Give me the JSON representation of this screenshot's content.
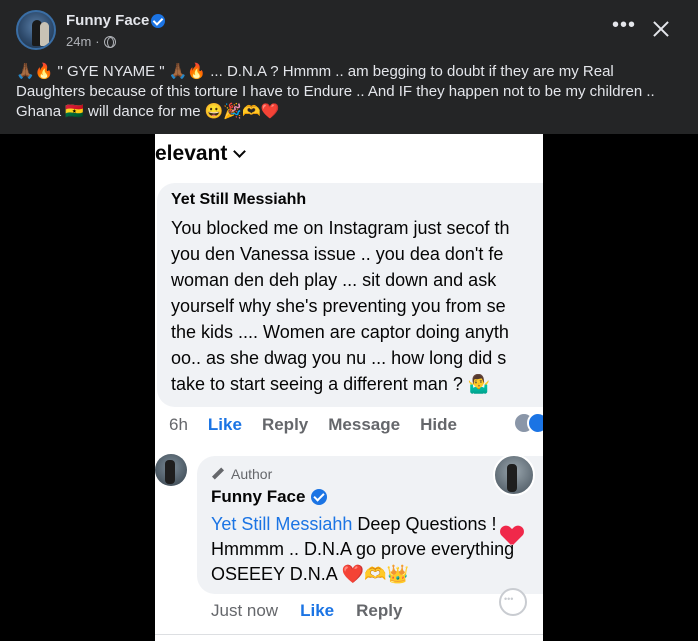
{
  "post": {
    "author": "Funny Face",
    "time": "24m",
    "separator": "·",
    "caption": "🙏🏾🔥 \" GYE NYAME \" 🙏🏾🔥 ...  D.N.A ? Hmmm  .. am begging to doubt if they are my Real Daughters because of this torture I have to Endure .. And IF they happen not to be my children .. Ghana 🇬🇭 will dance for me 😀🎉🫶❤️",
    "more_label": "•••"
  },
  "screenshot": {
    "filter_label": "elevant",
    "comment": {
      "author": "Yet Still Messiahh",
      "lines": [
        "You blocked me on Instagram just secof th",
        "you den Vanessa issue .. you dea don't fe",
        "woman den deh play ... sit down and ask",
        "yourself why she's preventing you from se",
        "the kids .... Women are captor doing anyth",
        "oo.. as she dwag you nu ... how long did s",
        "take to start seeing a different man ? 🤷‍♂️"
      ],
      "time": "6h",
      "like": "Like",
      "reply": "Reply",
      "message": "Message",
      "hide": "Hide"
    },
    "reply": {
      "badge": "Author",
      "author": "Funny Face",
      "mention": "Yet Still Messiahh",
      "line1_rest": " Deep Questions  !",
      "line2": "Hmmmm .. D.N.A go prove everything",
      "line3": "OSEEEY D.N.A  ❤️🫶👑",
      "time": "Just now",
      "like": "Like",
      "reply": "Reply"
    }
  }
}
